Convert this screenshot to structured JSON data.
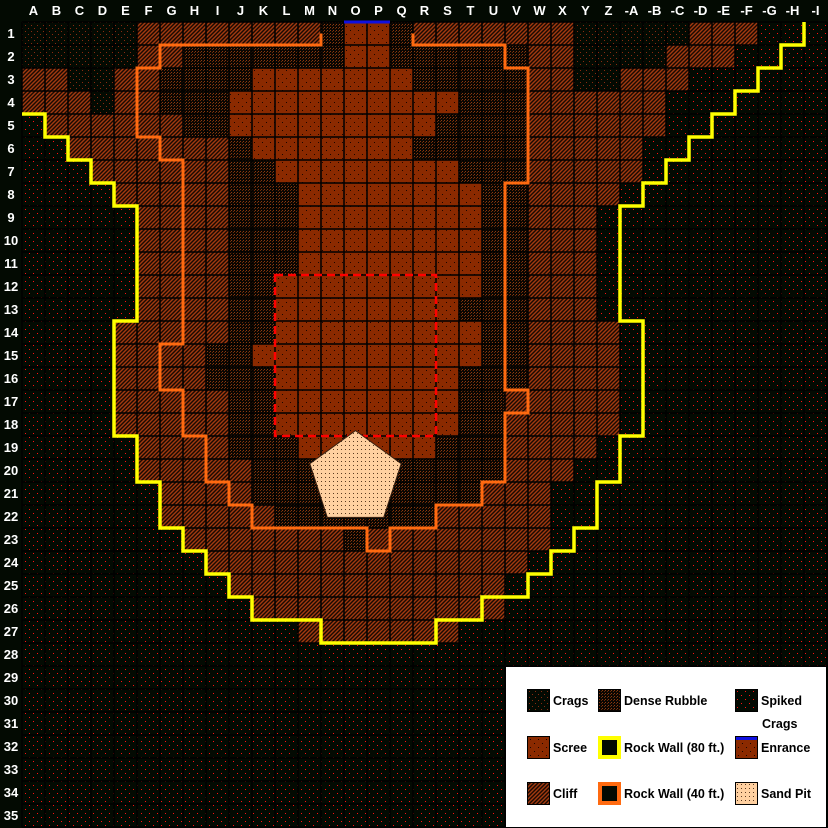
{
  "map": {
    "columns": [
      "A",
      "B",
      "C",
      "D",
      "E",
      "F",
      "G",
      "H",
      "I",
      "J",
      "K",
      "L",
      "M",
      "N",
      "O",
      "P",
      "Q",
      "R",
      "S",
      "T",
      "U",
      "V",
      "W",
      "X",
      "Y",
      "Z",
      "-A",
      "-B",
      "-C",
      "-D",
      "-E",
      "-F",
      "-G",
      "-H",
      "-I"
    ],
    "rows": [
      "1",
      "2",
      "3",
      "4",
      "5",
      "6",
      "7",
      "8",
      "9",
      "10",
      "11",
      "12",
      "13",
      "14",
      "15",
      "16",
      "17",
      "18",
      "19",
      "20",
      "21",
      "22",
      "23",
      "24",
      "25",
      "26",
      "27",
      "28",
      "29",
      "30",
      "31",
      "32",
      "33",
      "34",
      "35"
    ],
    "terrain_key": {
      ".": "spiked-crags",
      "c": "crags",
      "f": "cliff",
      "r": "dense-rubble",
      "s": "scree"
    },
    "terrain": [
      "cccccffffffffrssrfffffffcccccfff...",
      "cccccffrrrrrrrssrrrrrrffccccfff....",
      "ffccffrrrrsssssssrrrrrffccfff......",
      "fffcffrrrssssssssssrrrffffff.......",
      ".ffffffrrsssssssssrrrrffffff.......",
      "..fffffffrsssssssrrrrrfffff........",
      "...ffffffrrssssssssrrrfffff........",
      "....fffffrrrssssssssrrffff.........",
      ".....ffffrrrssssssssrrfff..........",
      ".....ffffrrrssssssssrrfff..........",
      ".....ffffrrrssssssssrrfff..........",
      ".....ffffrrsssssssssrrfff..........",
      ".....ffffrrssssssssrrrfff..........",
      "....fffffrrsssssssssrrffff.........",
      "....ffffrrssssssssssrrffff.........",
      "....ffffrrrssssssssrrrffff.........",
      "....fffffrrssssssssrrfffff.........",
      "....fffffrrssssssssrrfffff.........",
      ".....ffffrrrssssssrrrffff..........",
      ".....fffffrrrrrrrrrrrfff...........",
      "......ffffrrrrrrrrrrfff............",
      "......fffffrrrrrrrfffff............",
      ".......fffffffrffffffff............",
      "........ffffffffffffff.............",
      ".........ffffffffffff..............",
      "..........fffffffffff..............",
      "............fffffff................",
      "...................................",
      "...................................",
      "...................................",
      "...................................",
      "...................................",
      "...................................",
      "...................................",
      "..................................."
    ],
    "entrance": {
      "row": "1",
      "columns": [
        "O",
        "P"
      ]
    },
    "sand_pit_center": {
      "column": "O",
      "row": "20"
    },
    "highlight_region": {
      "from_column": "L",
      "to_column": "R",
      "from_row": "12",
      "to_row": "18",
      "style": "red-dashed"
    }
  },
  "colors": {
    "background": "#030a02",
    "scree": "#8b2a00",
    "cliff_hatch": "#a33a10",
    "rubble_dot": "#8b3a10",
    "crags_dot": "#7a2a10",
    "spiked_dot": "#ff1010",
    "wall_80": "#ffff00",
    "wall_40": "#ff6a10",
    "entrance": "#1010e0",
    "sand": "#ffd0a0",
    "highlight": "#ff0000"
  },
  "legend": {
    "items": [
      {
        "key": "crags",
        "label": "Crags"
      },
      {
        "key": "dense-rubble",
        "label": "Dense Rubble"
      },
      {
        "key": "spiked-crags",
        "label": "Spiked",
        "label2": "Crags"
      },
      {
        "key": "scree",
        "label": "Scree"
      },
      {
        "key": "wall-80",
        "label": "Rock Wall (80 ft.)"
      },
      {
        "key": "entrance",
        "label": "Enrance"
      },
      {
        "key": "cliff",
        "label": "Cliff"
      },
      {
        "key": "wall-40",
        "label": "Rock Wall (40 ft.)"
      },
      {
        "key": "sand-pit",
        "label": "Sand Pit"
      }
    ]
  }
}
